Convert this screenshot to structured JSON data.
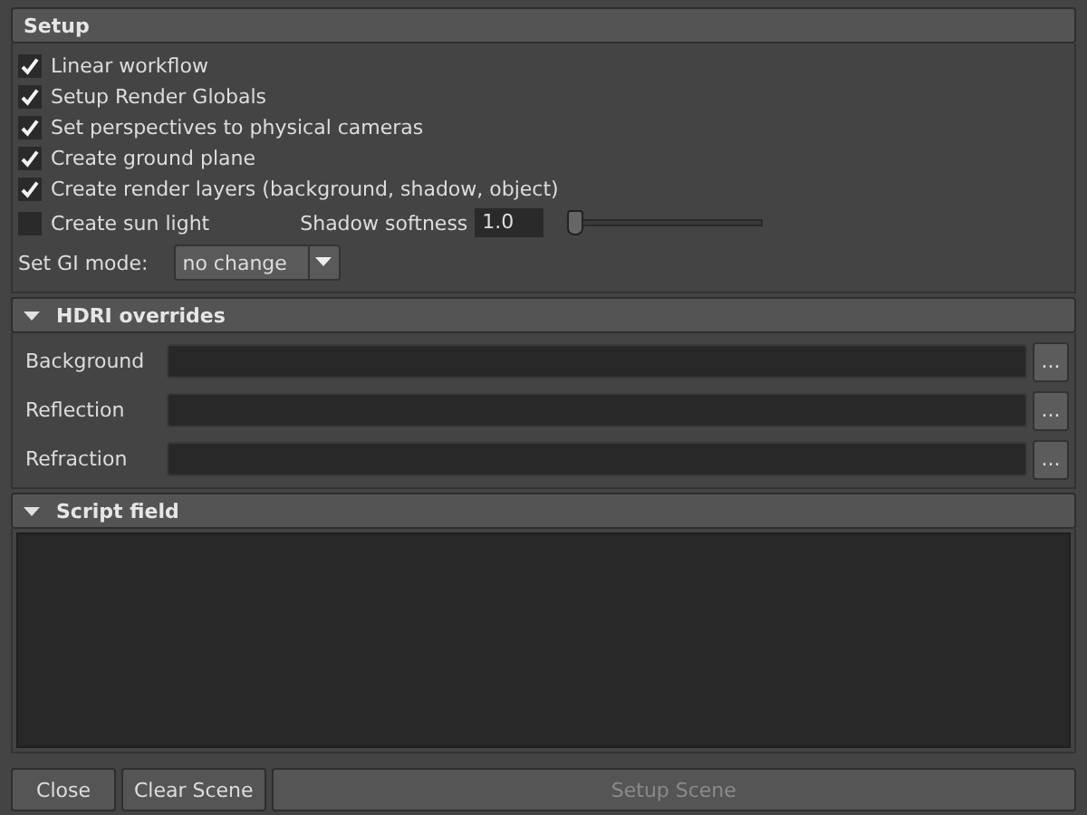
{
  "setup": {
    "title": "Setup",
    "options": [
      {
        "label": "Linear workflow",
        "checked": true
      },
      {
        "label": "Setup Render Globals",
        "checked": true
      },
      {
        "label": "Set perspectives to physical cameras",
        "checked": true
      },
      {
        "label": "Create ground plane",
        "checked": true
      },
      {
        "label": "Create render layers (background, shadow, object)",
        "checked": true
      }
    ],
    "sun_light": {
      "label": "Create sun light",
      "checked": false
    },
    "shadow_softness": {
      "label": "Shadow softness",
      "value": "1.0",
      "level": 0.0
    },
    "gi_mode": {
      "label": "Set GI mode:",
      "value": "no change"
    }
  },
  "hdri": {
    "title": "HDRI overrides",
    "expanded": true,
    "fields": [
      {
        "label": "Background",
        "button": "..."
      },
      {
        "label": "Reflection",
        "button": "..."
      },
      {
        "label": "Refraction",
        "button": "..."
      }
    ]
  },
  "script": {
    "title": "Script field",
    "expanded": true
  },
  "buttons": [
    {
      "label": "Close",
      "disabled": false
    },
    {
      "label": "Clear Scene",
      "disabled": false
    },
    {
      "label": "Setup Scene",
      "disabled": true
    }
  ]
}
